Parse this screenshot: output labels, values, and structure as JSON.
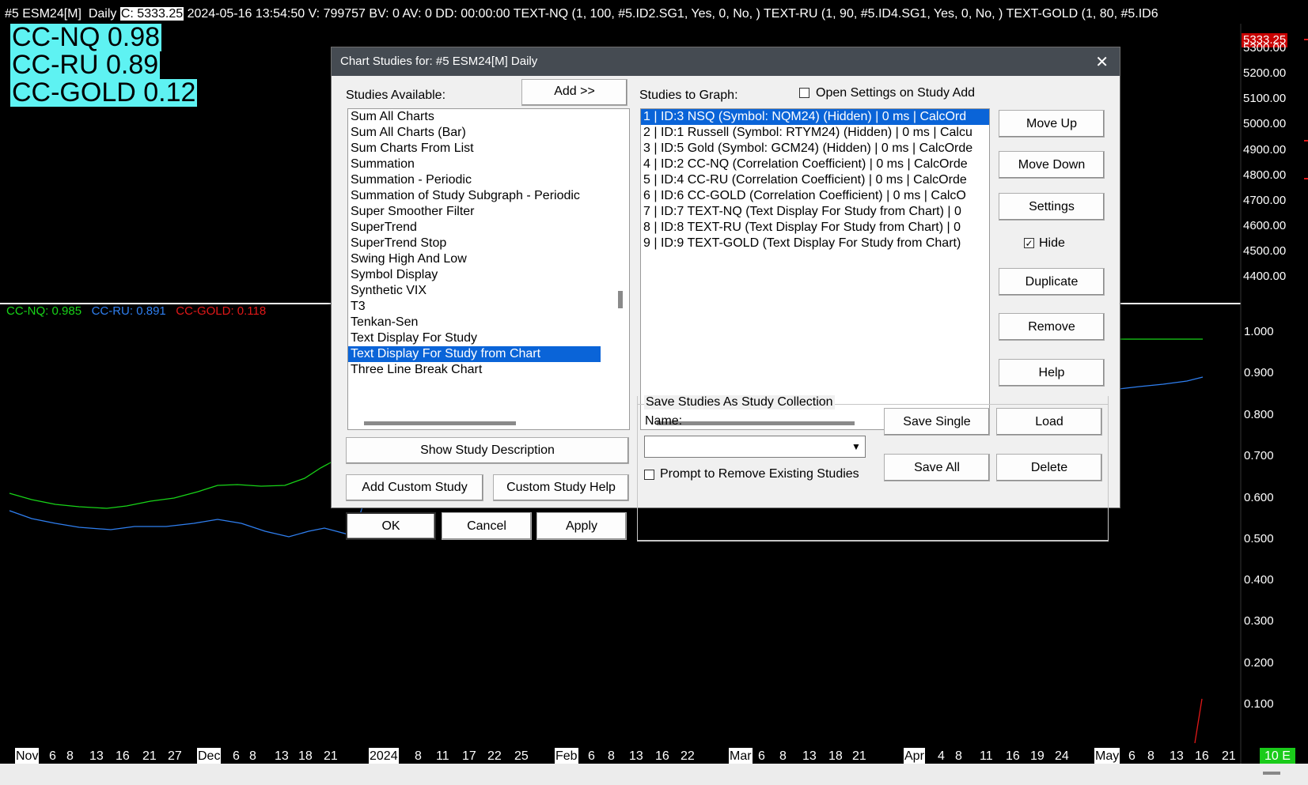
{
  "chart": {
    "header": {
      "symbol": "#5 ESM24[M]",
      "period": "Daily",
      "close": "C: 5333.25",
      "rest": "2024-05-16 13:54:50 V: 799757 BV: 0 AV: 0 DD: 00:00:00 TEXT-NQ   (1, 100, #5.ID2.SG1, Yes, 0, No, )  TEXT-RU   (1, 90, #5.ID4.SG1, Yes, 0, No, )  TEXT-GOLD   (1, 80, #5.ID6"
    },
    "cc_boxes": [
      "CC-NQ 0.98",
      "CC-RU 0.89",
      "CC-GOLD 0.12"
    ],
    "legend": {
      "nq": "CC-NQ: 0.985",
      "ru": "CC-RU: 0.891",
      "gold": "CC-GOLD: 0.118"
    },
    "price_tag": "5333.25",
    "price_axis": [
      "5300.00",
      "5200.00",
      "5100.00",
      "5000.00",
      "4900.00",
      "4800.00",
      "4700.00",
      "4600.00",
      "4500.00",
      "4400.00"
    ],
    "corr_axis": [
      "1.000",
      "0.900",
      "0.800",
      "0.700",
      "0.600",
      "0.500",
      "0.400",
      "0.300",
      "0.200",
      "0.100"
    ],
    "date_labels": [
      {
        "t": "Nov",
        "m": true
      },
      {
        "t": "6"
      },
      {
        "t": "8"
      },
      {
        "t": "13"
      },
      {
        "t": "16"
      },
      {
        "t": "21"
      },
      {
        "t": "27"
      },
      {
        "t": "Dec",
        "m": true
      },
      {
        "t": "6"
      },
      {
        "t": "8"
      },
      {
        "t": "13"
      },
      {
        "t": "18"
      },
      {
        "t": "21"
      },
      {
        "t": "2024",
        "m": true
      },
      {
        "t": "8"
      },
      {
        "t": "11"
      },
      {
        "t": "17"
      },
      {
        "t": "22"
      },
      {
        "t": "25"
      },
      {
        "t": "Feb",
        "m": true
      },
      {
        "t": "6"
      },
      {
        "t": "8"
      },
      {
        "t": "13"
      },
      {
        "t": "16"
      },
      {
        "t": "22"
      },
      {
        "t": "Mar",
        "m": true
      },
      {
        "t": "6"
      },
      {
        "t": "8"
      },
      {
        "t": "13"
      },
      {
        "t": "18"
      },
      {
        "t": "21"
      },
      {
        "t": "Apr",
        "m": true
      },
      {
        "t": "4"
      },
      {
        "t": "8"
      },
      {
        "t": "11"
      },
      {
        "t": "16"
      },
      {
        "t": "19"
      },
      {
        "t": "24"
      },
      {
        "t": "May",
        "m": true
      },
      {
        "t": "6"
      },
      {
        "t": "8"
      },
      {
        "t": "13"
      },
      {
        "t": "16"
      },
      {
        "t": "21"
      }
    ],
    "bars_tag": "10 E",
    "colors": {
      "nq": "#18d418",
      "ru": "#2f7ff0",
      "gold": "#e01818",
      "accent": "#0a64d8"
    }
  },
  "dialog": {
    "title": "Chart Studies for: #5 ESM24[M]  Daily",
    "studies_available_label": "Studies Available:",
    "add_label": "Add >>",
    "studies_available": [
      "Sum All Charts",
      "Sum All Charts (Bar)",
      "Sum Charts From List",
      "Summation",
      "Summation - Periodic",
      "Summation of Study Subgraph - Periodic",
      "Super Smoother Filter",
      "SuperTrend",
      "SuperTrend Stop",
      "Swing High And Low",
      "Symbol Display",
      "Synthetic VIX",
      "T3",
      "Tenkan-Sen",
      "Text Display For Study",
      "Text Display For Study from Chart",
      "Three Line Break Chart"
    ],
    "studies_available_selected": 15,
    "studies_to_graph_label": "Studies to Graph:",
    "open_settings_label": "Open Settings on Study Add",
    "studies_to_graph": [
      "1 | ID:3  NSQ (Symbol: NQM24) (Hidden) | 0 ms | CalcOrd",
      "2 | ID:1  Russell (Symbol: RTYM24) (Hidden) | 0 ms | Calcu",
      "3 | ID:5  Gold (Symbol: GCM24) (Hidden) | 0 ms | CalcOrde",
      "4 | ID:2  CC-NQ (Correlation Coefficient) | 0 ms | CalcOrde",
      "5 | ID:4  CC-RU (Correlation Coefficient) | 0 ms | CalcOrde",
      "6 | ID:6  CC-GOLD (Correlation Coefficient) | 0 ms | CalcO",
      "7 | ID:7  TEXT-NQ (Text Display For Study from Chart) | 0",
      "8 | ID:8  TEXT-RU (Text Display For Study from Chart) | 0",
      "9 | ID:9  TEXT-GOLD (Text Display For Study from Chart)"
    ],
    "studies_to_graph_selected": 0,
    "move_up": "Move Up",
    "move_down": "Move Down",
    "settings": "Settings",
    "hide_label": "Hide",
    "hide_checked": true,
    "duplicate": "Duplicate",
    "remove": "Remove",
    "help": "Help",
    "show_description": "Show Study Description",
    "add_custom": "Add Custom Study",
    "custom_help": "Custom Study Help",
    "ok": "OK",
    "cancel": "Cancel",
    "apply": "Apply",
    "collection_group": "Save Studies As Study Collection",
    "name_label": "Name:",
    "name_value": "",
    "save_single": "Save Single",
    "load": "Load",
    "save_all": "Save All",
    "delete": "Delete",
    "prompt_remove_label": "Prompt to Remove Existing Studies"
  }
}
